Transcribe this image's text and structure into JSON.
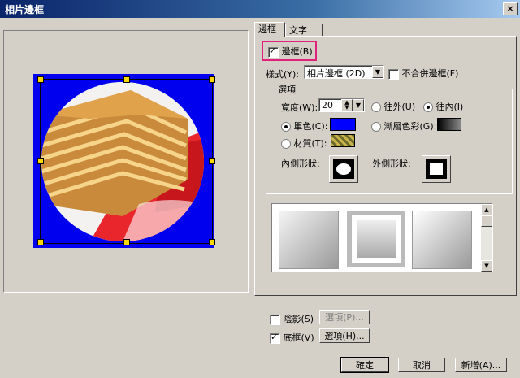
{
  "window": {
    "title": "相片邊框",
    "close_label": "×"
  },
  "tabs": [
    {
      "label": "邊框"
    },
    {
      "label": "文字"
    }
  ],
  "border_checkbox": {
    "label": "邊框(B)",
    "checked": true
  },
  "style": {
    "label": "樣式(Y):",
    "value": "相片邊框 (2D)"
  },
  "no_merge": {
    "label": "不合併邊框(F)",
    "checked": false
  },
  "options_group": {
    "legend": "選項",
    "width_label": "寬度(W):",
    "width_value": "20",
    "outside_label": "往外(U)",
    "inside_label": "往內(I)",
    "direction": "inside",
    "solid_label": "單色(C):",
    "gradient_label": "漸層色彩(G):",
    "texture_label": "材質(T):",
    "fill_type": "solid",
    "solid_color": "#0000ff",
    "inner_shape_label": "內側形狀:",
    "outer_shape_label": "外側形狀:",
    "inner_shape": "circle-icon",
    "outer_shape": "square-icon"
  },
  "shadow": {
    "label": "陰影(S)",
    "checked": false,
    "options_label": "選項(P)..."
  },
  "mat": {
    "label": "底框(V)",
    "checked": true,
    "options_label": "選項(H)..."
  },
  "buttons": {
    "ok": "確定",
    "cancel": "取消",
    "add": "新增(A)..."
  },
  "colors": {
    "title_bar": "#0a246a",
    "frame_blue": "#0000ee",
    "highlight": "#e0207a",
    "dialog_bg": "#d4d0c8"
  }
}
